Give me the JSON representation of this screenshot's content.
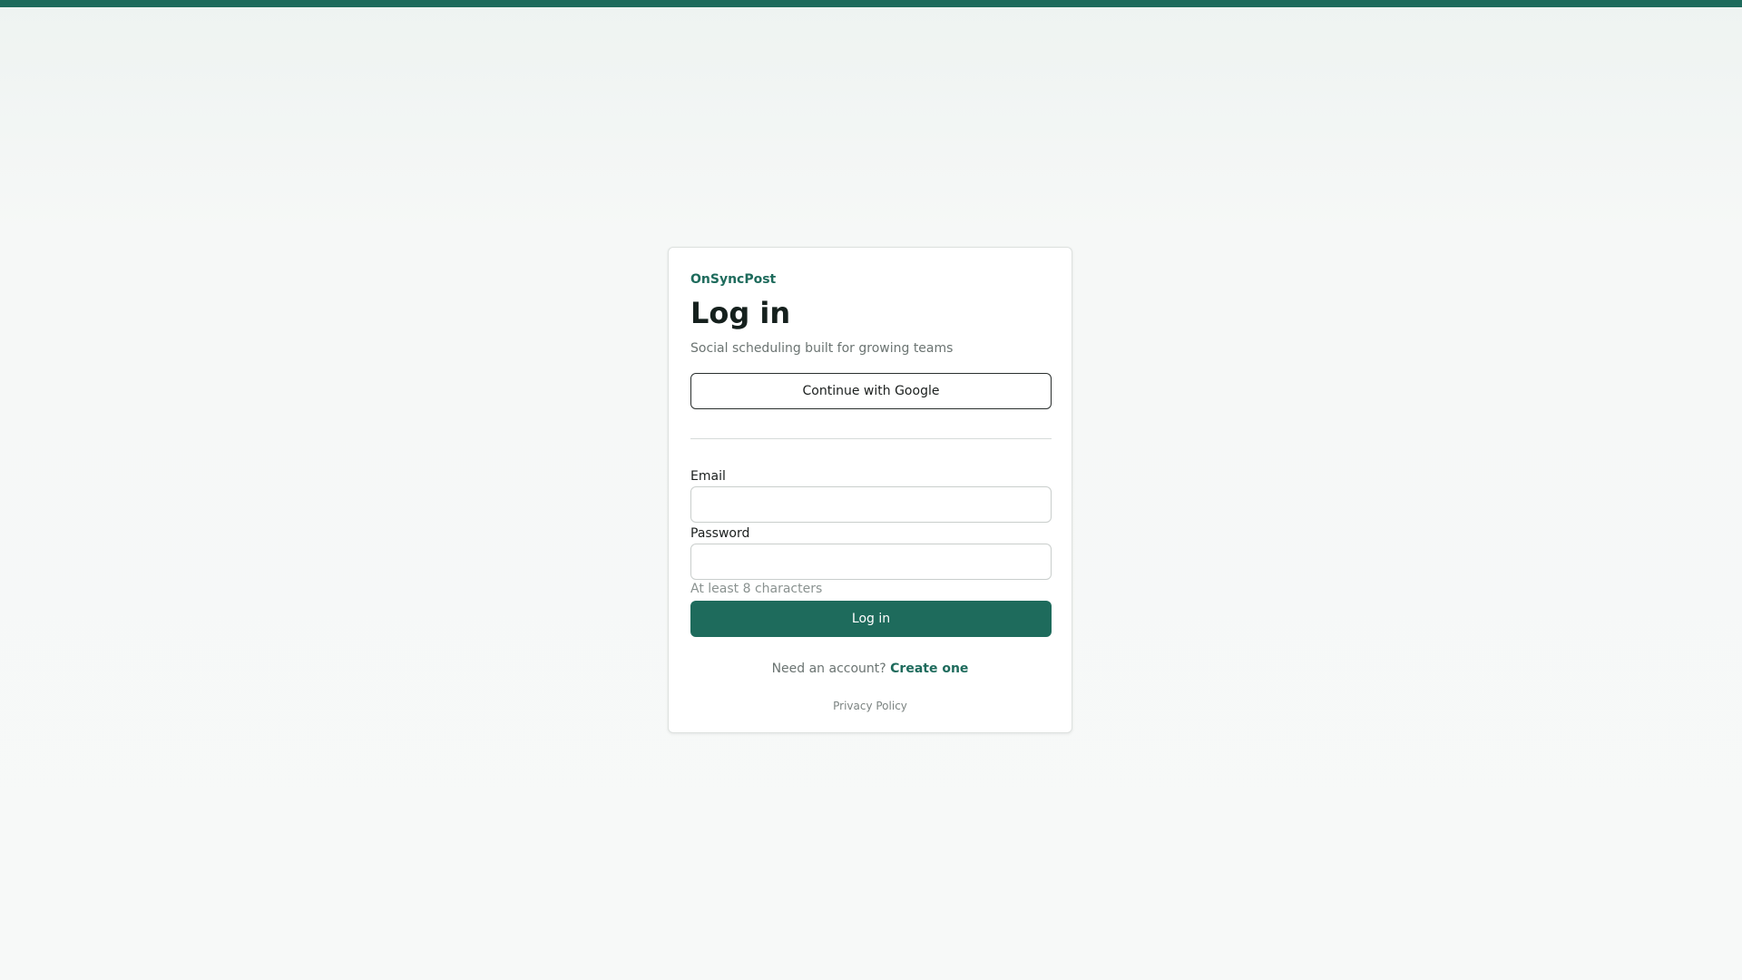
{
  "colors": {
    "accent": "#1e6b5c",
    "background": "#f6f8f7",
    "card": "#ffffff"
  },
  "login": {
    "brand": "OnSyncPost",
    "title": "Log in",
    "subtitle": "Social scheduling built for growing teams",
    "google_button": "Continue with Google",
    "email": {
      "label": "Email",
      "value": "",
      "placeholder": ""
    },
    "password": {
      "label": "Password",
      "value": "",
      "placeholder": "",
      "hint": "At least 8 characters"
    },
    "submit_button": "Log in",
    "signup_prompt": "Need an account?",
    "signup_link": "Create one",
    "privacy_link": "Privacy Policy"
  }
}
